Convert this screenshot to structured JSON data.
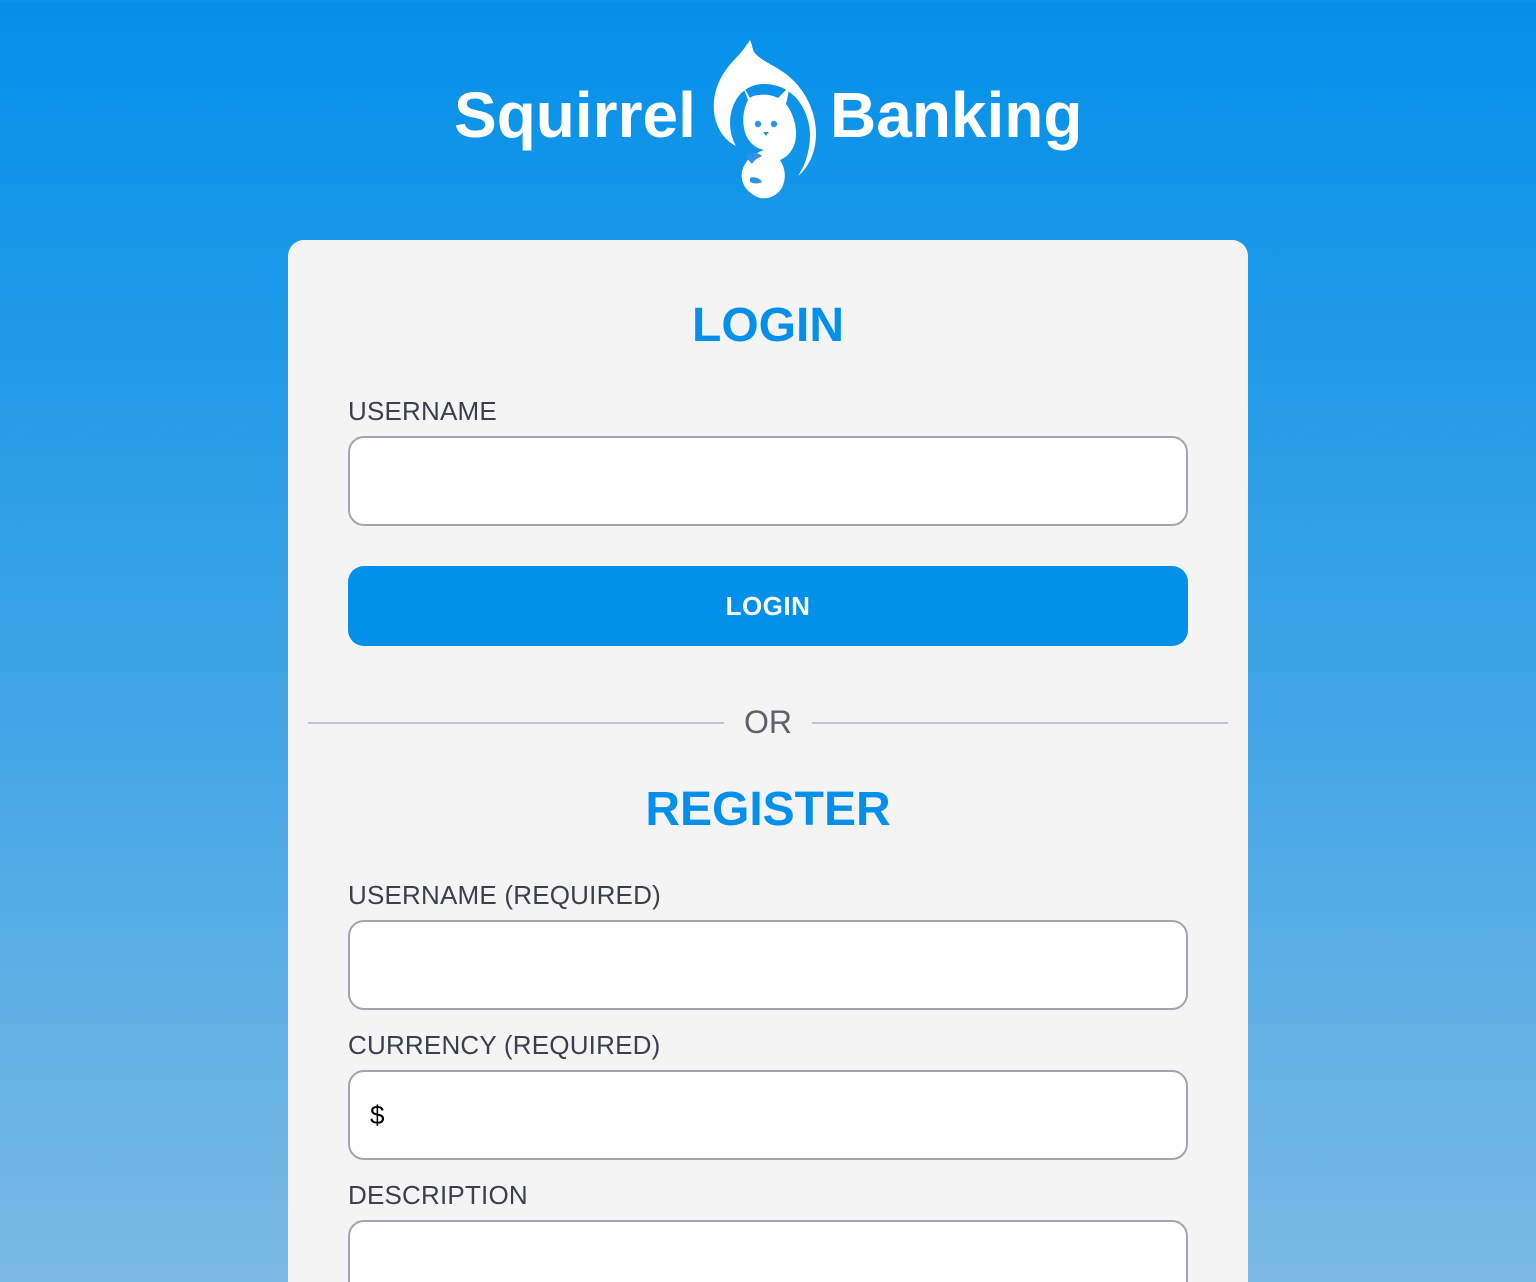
{
  "brand": {
    "name_left": "Squirrel",
    "name_right": "Banking",
    "logo_icon": "squirrel-icon"
  },
  "login": {
    "title": "LOGIN",
    "username_label": "USERNAME",
    "username_value": "",
    "button_label": "LOGIN"
  },
  "divider": {
    "text": "OR"
  },
  "register": {
    "title": "REGISTER",
    "username_label": "USERNAME (REQUIRED)",
    "username_value": "",
    "currency_label": "CURRENCY (REQUIRED)",
    "currency_value": "$",
    "description_label": "DESCRIPTION",
    "description_value": ""
  },
  "colors": {
    "accent": "#0390ea",
    "card_background": "#f4f4f5",
    "label_text": "#3d3f4d"
  }
}
